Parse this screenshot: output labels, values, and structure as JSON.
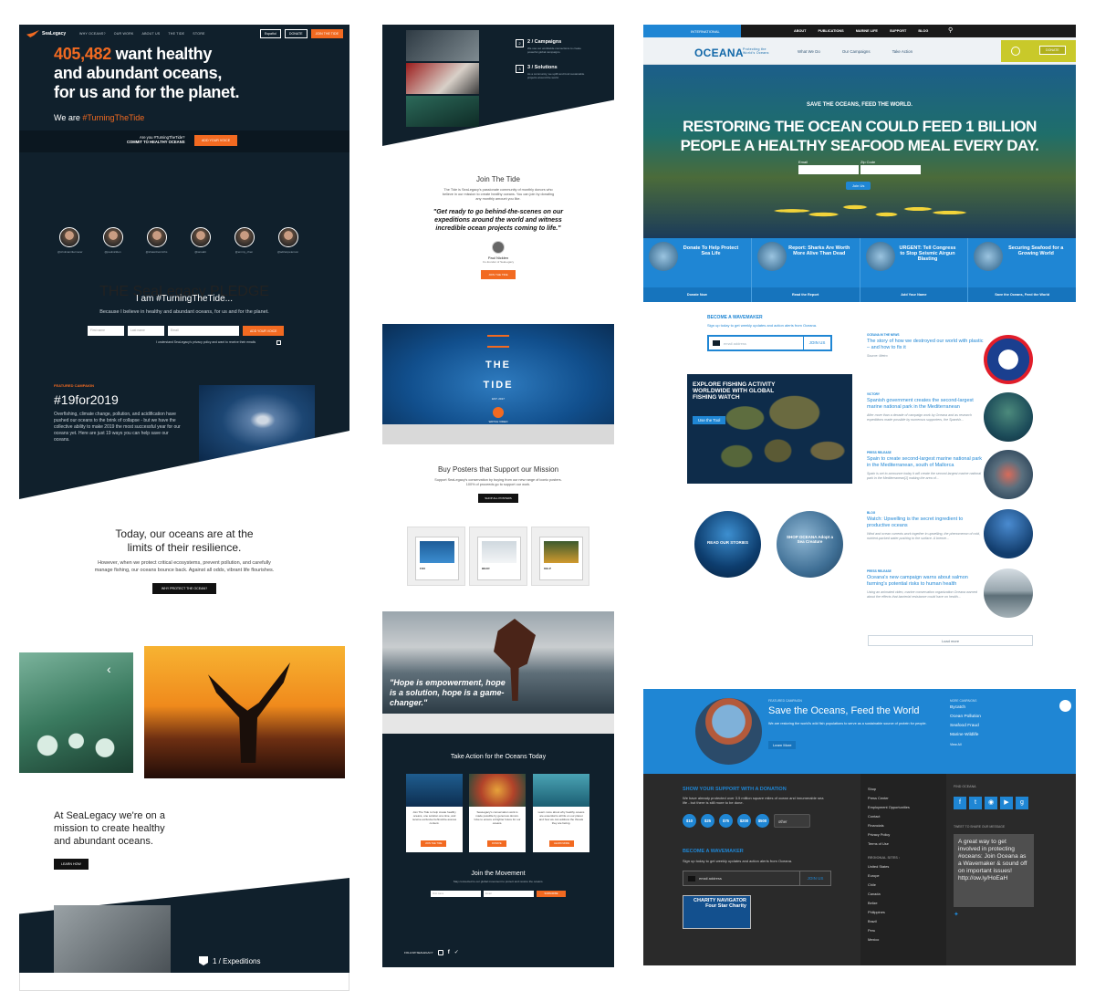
{
  "sealegacy": {
    "brand": "SeaLegacy",
    "nav": [
      "WHY OCEANS?",
      "OUR WORK",
      "ABOUT US",
      "THE TIDE",
      "STORE"
    ],
    "lang_btn": "Español",
    "donate_btn": "DONATE",
    "join_btn": "JOIN THE TIDE",
    "hero_count": "405,482",
    "hero_line1": "want healthy",
    "hero_line2": "and abundant oceans,",
    "hero_line3": "for us and for the planet.",
    "we_are": "We are",
    "hashtag": "#TurningTheTide",
    "band_q1": "Are you #TurningTheTide?",
    "band_q2": "COMMIT TO HEALTHY OCEANS",
    "add_voice_btn": "ADD YOUR VOICE",
    "people": [
      "@cristinamittermeier",
      "@paulnicklen",
      "@shawnheinrichs",
      "@iansalit",
      "@emmy_chen",
      "@adrianpeterson"
    ],
    "pledge_kicker": "THE SeaLegacy PLEDGE",
    "pledge_title": "I am #TurningTheTide...",
    "pledge_text": "Because I believe in healthy and abundant oceans, for us and for the planet.",
    "first_name_ph": "First name",
    "last_name_ph": "Last name",
    "email_ph": "Email",
    "form_btn": "ADD YOUR VOICE",
    "privacy": "I understand SeaLegacy's privacy policy and want to receive their emails",
    "featured_kicker": "FEATURED CAMPAIGN",
    "featured_title": "#19for2019",
    "featured_text": "Overfishing, climate change, pollution, and acidification have pushed our oceans to the brink of collapse - but we have the collective ability to make 2019 the most successful year for our oceans yet. Here are just 19 ways you can help save our oceans.",
    "today_title": "Today, our oceans are at the limits of their resilience.",
    "today_text": "However, when we protect critical ecosystems, prevent pollution, and carefully manage fishing, our oceans bounce back. Against all odds, vibrant life flourishes.",
    "why_btn": "WHY PROTECT THE OCEAN?",
    "mission": "At SeaLegacy we're on a mission to create healthy and abundant oceans.",
    "learn_btn": "LEARN HOW",
    "expeditions": "1 / Expeditions"
  },
  "tide": {
    "steps": [
      {
        "num": "2",
        "title": "2 / Campaigns",
        "text": "We use our worldwide connections to create powerful global campaigns."
      },
      {
        "num": "3",
        "title": "3 / Solutions",
        "text": "As a community, we uplift and fund sustainable projects around the world."
      }
    ],
    "join_title": "Join The Tide",
    "join_text": "The Tide is SeaLegacy's passionate community of monthly donors who believe in our mission to create healthy oceans. You can join by donating any monthly amount you like.",
    "quote": "\"Get ready to go behind-the-scenes on our expeditions around the world and witness incredible ocean projects coming to life.\"",
    "quote_name": "Paul Nicklen",
    "quote_role": "Co-founder of SeaLegacy",
    "join_btn": "JOIN THE TIDE",
    "logo_word": "THE TIDE",
    "logo_est": "EST. 2017",
    "watch": "WATCH VIDEO",
    "posters_title": "Buy Posters that Support our Mission",
    "posters_text": "Support SeaLegacy's conservation by buying from our new range of iconic posters. 100% of proceeds go to support our work.",
    "posters_btn": "SHOP ALL POSTERS",
    "posters": [
      "FOX",
      "BEAR",
      "KELP"
    ],
    "hope_quote": "\"Hope is empowerment, hope is a solution, hope is a game-changer.\"",
    "act_title": "Take Action for the Oceans Today",
    "cards": [
      {
        "text": "Join The Tide to help create healthy oceans, one solution at a time, and receive exclusive behind-the-scenes content.",
        "btn": "JOIN THE TIDE"
      },
      {
        "text": "SeaLegacy's conservation work is made possible by generous donors. Give to ensure a brighter future for our oceans.",
        "btn": "DONATE"
      },
      {
        "text": "Learn more about why healthy oceans are essential to all life on our planet and how we can address the threats they are facing.",
        "btn": "LEARN MORE"
      }
    ],
    "movement_title": "Join the Movement",
    "movement_text": "Stay connected to our global movement to protect and restore the oceans.",
    "mv_first": "First name",
    "mv_email": "Email",
    "mv_btn": "SUBSCRIBE",
    "follow": "FOLLOW SEALEGACY"
  },
  "oceana": {
    "intl": "INTERNATIONAL",
    "top_nav": [
      "ABOUT",
      "PUBLICATIONS",
      "MARINE LIFE",
      "SUPPORT",
      "BLOG"
    ],
    "logo": "OCEANA",
    "tagline": "Protecting the World's Oceans",
    "nav": [
      "What We Do",
      "Our Campaigns",
      "Take Action"
    ],
    "donate_btn": "DONATE",
    "hero_kicker": "SAVE THE OCEANS, FEED THE WORLD.",
    "hero_title": "RESTORING THE OCEAN COULD FEED 1 BILLION PEOPLE A HEALTHY SEAFOOD MEAL EVERY DAY.",
    "email_label": "Email",
    "zip_label": "Zip Code",
    "join_btn": "Join Us",
    "cards": [
      {
        "title": "Donate To Help Protect Sea Life",
        "cta": "Donate Now"
      },
      {
        "title": "Report: Sharks Are Worth More Alive Than Dead",
        "cta": "Read the Report"
      },
      {
        "title": "URGENT: Tell Congress to Stop Seismic Airgun Blasting",
        "cta": "Add Your Name"
      },
      {
        "title": "Securing Seafood for a Growing World",
        "cta": "Save the Oceans, Feed the World"
      }
    ],
    "wave_title": "BECOME A WAVEMAKER",
    "wave_text": "Sign up today to get weekly updates and action alerts from Oceana.",
    "email_ph": "email address",
    "join_us": "JOIN US",
    "map_title": "EXPLORE FISHING ACTIVITY WORLDWIDE WITH GLOBAL FISHING WATCH",
    "map_btn": "Use the Tool",
    "stories": "READ OUR STORIES",
    "shop": "SHOP OCEANA Adopt a Sea Creature",
    "news": [
      {
        "kicker": "OCEANA IN THE NEWS",
        "title": "The story of how we destroyed our world with plastic – and how to fix it",
        "src": "Source: Metro"
      },
      {
        "kicker": "VICTORY",
        "title": "Spanish government creates the second-largest marine national park in the Mediterranean",
        "src": "After more than a decade of campaign work by Oceana and as research expeditions made possible by numerous supporters, the Spanish..."
      },
      {
        "kicker": "PRESS RELEASE",
        "title": "Spain to create second-largest marine national park in the Mediterranean, south of Mallorca",
        "src": "Spain is set to announce today it will create the second-largest marine national park in the Mediterranean[1] making the area of..."
      },
      {
        "kicker": "BLOG",
        "title": "Watch: Upwelling is the secret ingredient to productive oceans",
        "src": "Wind and ocean currents work together in upwelling, the phenomenon of cold, nutrient-packed water pushing to the surface. A breeze..."
      },
      {
        "kicker": "PRESS RELEASE",
        "title": "Oceana's new campaign warns about salmon farming's potential risks to human health",
        "src": "Using an animated video, marine conservation organization Oceana warned about the effects that bacterial resistance could have on health..."
      }
    ],
    "load_more": "Load more",
    "featured_kicker": "FEATURED CAMPAIGN",
    "featured_title": "Save the Oceans, Feed the World",
    "featured_text": "We are restoring the world's wild fish populations to serve as a sustainable source of protein for people.",
    "learn_more": "Learn More",
    "more_kicker": "MORE CAMPAIGNS",
    "more_campaigns": [
      "Bycatch",
      "Ocean Pollution",
      "Seafood Fraud",
      "Marine Wildlife",
      "View All"
    ],
    "support_title": "SHOW YOUR SUPPORT WITH A DONATION",
    "support_text": "We have already protected over 3.5 million square miles of ocean and innumerable sea life - but there is still more to be done.",
    "amounts": [
      "$10",
      "$25",
      "$75",
      "$200",
      "$500"
    ],
    "other": "other",
    "foot_wave": "BECOME A WAVEMAKER",
    "foot_wave_text": "Sign up today to get weekly updates and action alerts from Oceana.",
    "foot_email": "email address",
    "foot_join": "JOIN US",
    "charity": "CHARITY NAVIGATOR Four Star Charity",
    "links": [
      "Shop",
      "Press Center",
      "Employment Opportunities",
      "Contact",
      "Financials",
      "Privacy Policy",
      "Terms of Use"
    ],
    "regional_title": "REGIONAL SITES :",
    "regional": [
      "United States",
      "Europe",
      "Chile",
      "Canada",
      "Belize",
      "Philippines",
      "Brazil",
      "Peru",
      "Mexico"
    ],
    "find": "FIND OCEANA",
    "tweet_kicker": "TWEET TO SHARE OUR MESSAGE",
    "tweet": "A great way to get involved in protecting #oceans: Join Oceana as a Wavemaker & sound off on important issues! http://ow.ly/HoEaH"
  }
}
